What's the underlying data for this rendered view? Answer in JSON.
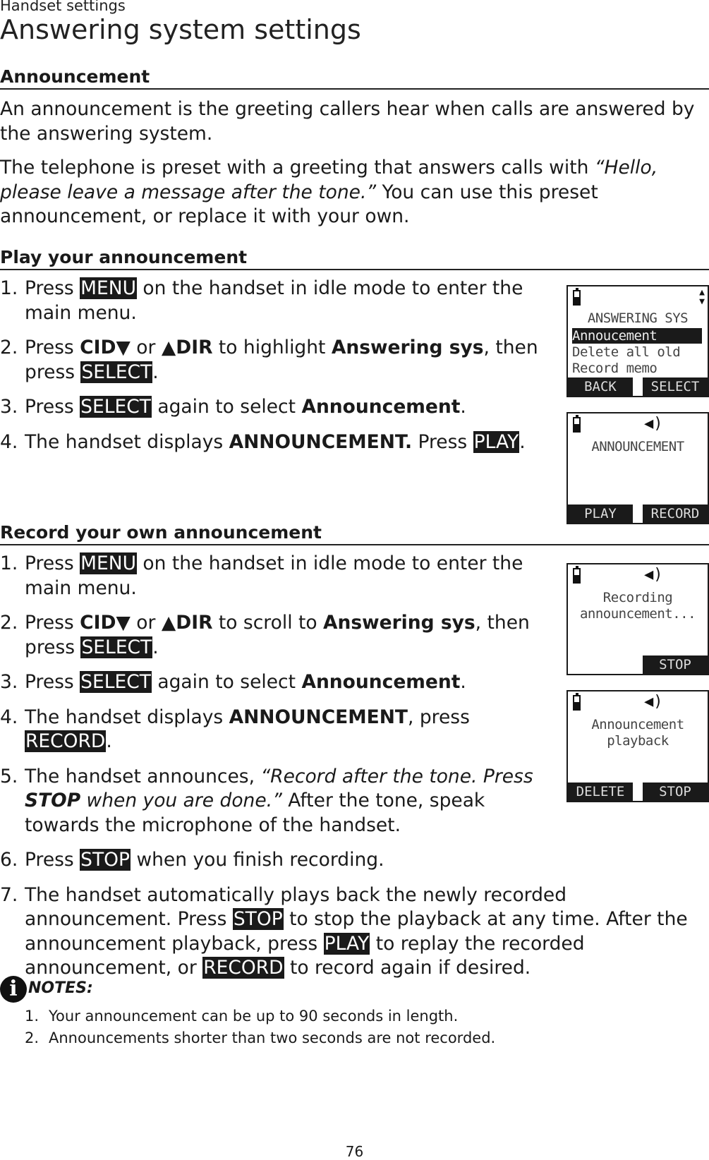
{
  "header": {
    "section": "Handset settings",
    "title": "Answering system settings"
  },
  "announcement": {
    "heading": "Announcement",
    "paragraphs": [
      [
        {
          "t": "An announcement is the greeting callers hear when calls are answered by the answering system.",
          "s": ""
        }
      ],
      [
        {
          "t": "The telephone is preset with a greeting that answers calls with ",
          "s": ""
        },
        {
          "t": "“Hello, please leave a message after the tone.”",
          "s": "i"
        },
        {
          "t": " You can use this preset announcement, or replace it with your own.",
          "s": ""
        }
      ]
    ]
  },
  "play": {
    "heading": "Play your announcement",
    "steps": [
      [
        {
          "t": "Press ",
          "s": ""
        },
        {
          "t": "MENU",
          "s": "key"
        },
        {
          "t": " on the handset in idle mode to enter the main menu.",
          "s": ""
        }
      ],
      [
        {
          "t": "Press ",
          "s": ""
        },
        {
          "t": "CID▼",
          "s": "b"
        },
        {
          "t": " or ",
          "s": ""
        },
        {
          "t": "▲DIR",
          "s": "b"
        },
        {
          "t": " to highlight ",
          "s": ""
        },
        {
          "t": "Answering sys",
          "s": "b"
        },
        {
          "t": ", then press ",
          "s": ""
        },
        {
          "t": "SELECT",
          "s": "key"
        },
        {
          "t": ".",
          "s": ""
        }
      ],
      [
        {
          "t": "Press ",
          "s": ""
        },
        {
          "t": "SELECT",
          "s": "key"
        },
        {
          "t": " again to select ",
          "s": ""
        },
        {
          "t": "Announcement",
          "s": "b"
        },
        {
          "t": ".",
          "s": ""
        }
      ],
      [
        {
          "t": "The handset displays ",
          "s": ""
        },
        {
          "t": "ANNOUNCEMENT.",
          "s": "b"
        },
        {
          "t": " Press ",
          "s": ""
        },
        {
          "t": "PLAY",
          "s": "key"
        },
        {
          "t": ".",
          "s": ""
        }
      ]
    ]
  },
  "record": {
    "heading": "Record your own announcement",
    "steps": [
      [
        {
          "t": "Press ",
          "s": ""
        },
        {
          "t": "MENU",
          "s": "key"
        },
        {
          "t": " on the handset in idle mode to enter the main menu.",
          "s": ""
        }
      ],
      [
        {
          "t": "Press ",
          "s": ""
        },
        {
          "t": "CID▼",
          "s": "b"
        },
        {
          "t": " or ",
          "s": ""
        },
        {
          "t": "▲DIR",
          "s": "b"
        },
        {
          "t": " to scroll to ",
          "s": ""
        },
        {
          "t": "Answering sys",
          "s": "b"
        },
        {
          "t": ", then press ",
          "s": ""
        },
        {
          "t": "SELECT",
          "s": "key"
        },
        {
          "t": ".",
          "s": ""
        }
      ],
      [
        {
          "t": "Press ",
          "s": ""
        },
        {
          "t": "SELECT",
          "s": "key"
        },
        {
          "t": " again to select ",
          "s": ""
        },
        {
          "t": "Announcement",
          "s": "b"
        },
        {
          "t": ".",
          "s": ""
        }
      ],
      [
        {
          "t": "The handset displays ",
          "s": ""
        },
        {
          "t": "ANNOUNCEMENT",
          "s": "b"
        },
        {
          "t": ", press ",
          "s": ""
        },
        {
          "t": "RECORD",
          "s": "key"
        },
        {
          "t": ".",
          "s": ""
        }
      ],
      [
        {
          "t": "The handset announces, ",
          "s": ""
        },
        {
          "t": "“Record after the tone. Press ",
          "s": "i"
        },
        {
          "t": "STOP",
          "s": "bi"
        },
        {
          "t": " when you are done.”",
          "s": "i"
        },
        {
          "t": " After the tone, speak towards the microphone of the handset.",
          "s": ""
        }
      ],
      [
        {
          "t": "Press ",
          "s": ""
        },
        {
          "t": "STOP",
          "s": "key"
        },
        {
          "t": " when you finish recording.",
          "s": ""
        }
      ],
      [
        {
          "t": "The handset automatically plays back the newly recorded announcement. Press ",
          "s": ""
        },
        {
          "t": "STOP",
          "s": "key"
        },
        {
          "t": " to stop the playback at any time. After the announcement playback, press ",
          "s": ""
        },
        {
          "t": "PLAY",
          "s": "key"
        },
        {
          "t": " to replay the recorded announcement, or ",
          "s": ""
        },
        {
          "t": "RECORD",
          "s": "key"
        },
        {
          "t": " to record again if desired.",
          "s": ""
        }
      ]
    ]
  },
  "screens": [
    {
      "lines": [
        "ANSWERING SYS"
      ],
      "menu": [
        "Annoucement",
        "Delete all old",
        "Record memo"
      ],
      "highlight": 0,
      "left_key": "BACK",
      "right_key": "SELECT",
      "icons": [
        "battery-icon",
        "scroll-arrows-icon"
      ]
    },
    {
      "lines": [
        "ANNOUNCEMENT"
      ],
      "left_key": "PLAY",
      "right_key": "RECORD",
      "icons": [
        "battery-icon",
        "speaker-icon"
      ]
    },
    {
      "lines": [
        "Recording",
        "announcement..."
      ],
      "right_key": "STOP",
      "icons": [
        "battery-icon",
        "speaker-icon"
      ]
    },
    {
      "lines": [
        "Announcement",
        "playback"
      ],
      "left_key": "DELETE",
      "right_key": "STOP",
      "icons": [
        "battery-icon",
        "speaker-icon"
      ]
    }
  ],
  "notes": {
    "icon": "info-icon",
    "label": "NOTES:",
    "items": [
      "Your announcement can be up to 90 seconds in length.",
      "Announcements shorter than two seconds are not recorded."
    ]
  },
  "page_number": "76"
}
